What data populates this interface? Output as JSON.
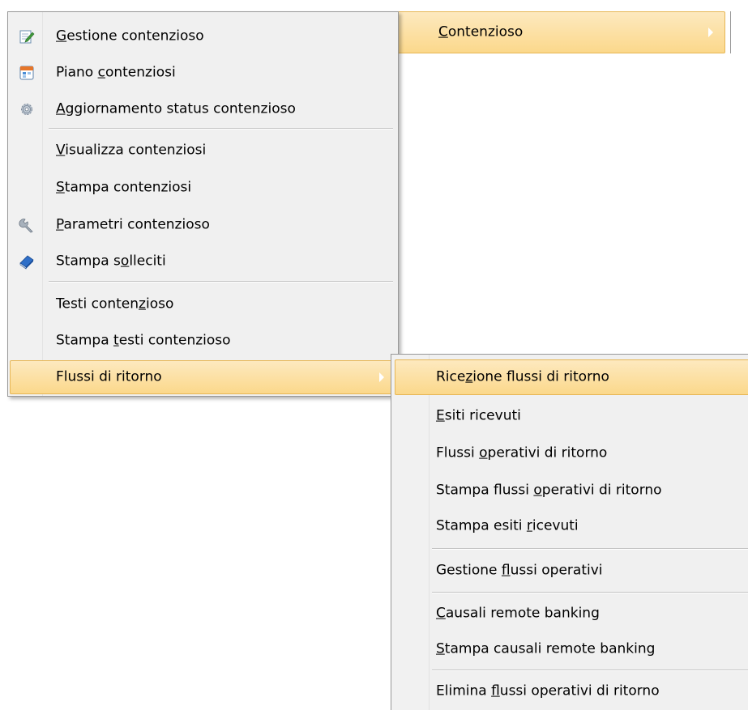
{
  "menubar": {
    "item": {
      "pre": "",
      "mn": "C",
      "post": "ontenzioso"
    }
  },
  "main_menu": {
    "items": [
      {
        "pre": "",
        "mn": "G",
        "post": "estione contenzioso",
        "icon": "edit-document-icon"
      },
      {
        "pre": "Piano ",
        "mn": "c",
        "post": "ontenziosi",
        "icon": "calendar-plan-icon"
      },
      {
        "pre": "",
        "mn": "A",
        "post": "ggiornamento status contenzioso",
        "icon": "gear-icon"
      },
      {
        "pre": "",
        "mn": "V",
        "post": "isualizza contenziosi"
      },
      {
        "pre": "",
        "mn": "S",
        "post": "tampa contenziosi"
      },
      {
        "pre": "",
        "mn": "P",
        "post": "arametri contenzioso",
        "icon": "wrench-icon"
      },
      {
        "pre": "Stampa s",
        "mn": "o",
        "post": "lleciti",
        "icon": "book-icon"
      },
      {
        "pre": "Testi conten",
        "mn": "z",
        "post": "ioso"
      },
      {
        "pre": "Stampa ",
        "mn": "t",
        "post": "esti contenzioso"
      },
      {
        "pre": "Flussi di ritorno",
        "mn": "",
        "post": ""
      }
    ]
  },
  "sub_menu": {
    "items": [
      {
        "pre": "Rice",
        "mn": "z",
        "post": "ione flussi di ritorno"
      },
      {
        "pre": "",
        "mn": "E",
        "post": "siti ricevuti"
      },
      {
        "pre": "Flussi ",
        "mn": "o",
        "post": "perativi di ritorno"
      },
      {
        "pre": "Stampa flussi ",
        "mn": "o",
        "post": "perativi di ritorno"
      },
      {
        "pre": "Stampa esiti ",
        "mn": "r",
        "post": "icevuti"
      },
      {
        "pre": "Gestione ",
        "mn": "f",
        "post": "lussi operativi"
      },
      {
        "pre": "",
        "mn": "C",
        "post": "ausali remote banking"
      },
      {
        "pre": "",
        "mn": "S",
        "post": "tampa causali remote banking"
      },
      {
        "pre": "Elimina ",
        "mn": "f",
        "post": "lussi operativi di ritorno"
      }
    ]
  },
  "colors": {
    "highlight_top": "#fde9bf",
    "highlight_bottom": "#fbd88b",
    "highlight_border": "#e7b654",
    "menu_bg": "#f0f0f0"
  }
}
